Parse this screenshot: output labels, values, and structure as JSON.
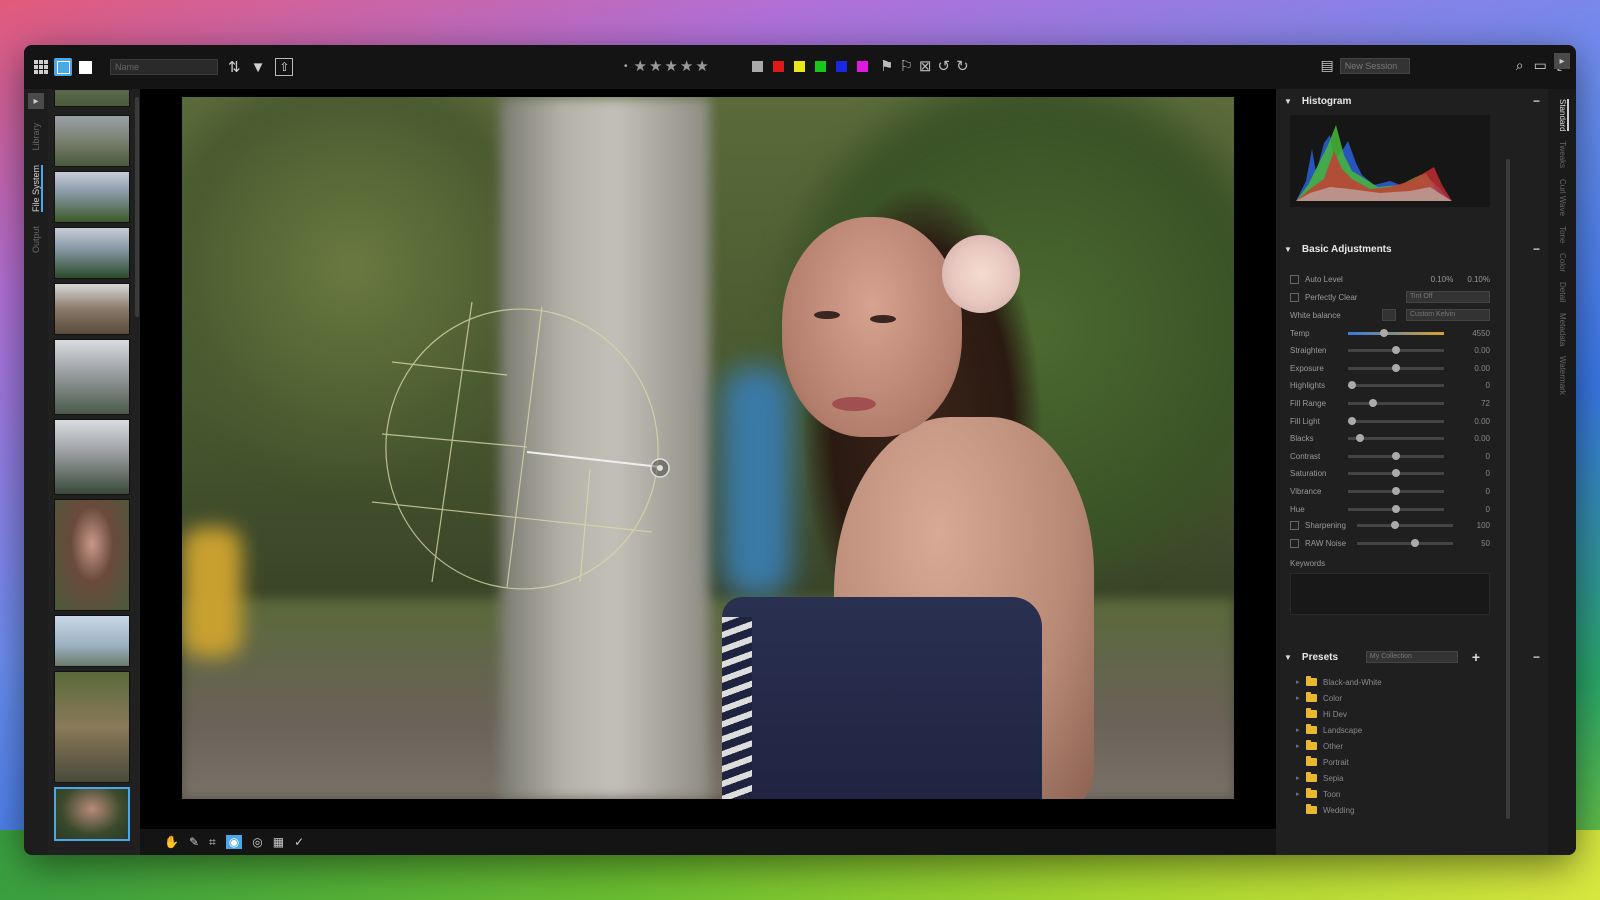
{
  "toolbar": {
    "search_placeholder": "Name",
    "view_select": "New Session"
  },
  "left_tabs": [
    "Library",
    "File System",
    "Output"
  ],
  "main_tools": [
    "pan",
    "brush",
    "crop",
    "spot",
    "eye",
    "mask",
    "pen"
  ],
  "histogram": {
    "title": "Histogram"
  },
  "basic": {
    "title": "Basic Adjustments",
    "auto_level": "Auto Level",
    "auto_level_vals": [
      "0.10%",
      "0.10%"
    ],
    "perfectly_clear": "Perfectly Clear",
    "perfectly_clear_value": "Tint Off",
    "white_balance": "White balance",
    "white_balance_value": "Custom Kelvin",
    "sliders": [
      {
        "label": "Temp",
        "value": "4550",
        "pos": 0.38
      },
      {
        "label": "Straighten",
        "value": "0.00",
        "pos": 0.5
      },
      {
        "label": "Exposure",
        "value": "0.00",
        "pos": 0.5
      },
      {
        "label": "Highlights",
        "value": "0",
        "pos": 0.04
      },
      {
        "label": "Fill Range",
        "value": "72",
        "pos": 0.26
      },
      {
        "label": "Fill Light",
        "value": "0.00",
        "pos": 0.04
      },
      {
        "label": "Blacks",
        "value": "0.00",
        "pos": 0.12
      },
      {
        "label": "Contrast",
        "value": "0",
        "pos": 0.5
      },
      {
        "label": "Saturation",
        "value": "0",
        "pos": 0.5
      },
      {
        "label": "Vibrance",
        "value": "0",
        "pos": 0.5
      },
      {
        "label": "Hue",
        "value": "0",
        "pos": 0.5
      }
    ],
    "sharpening": {
      "label": "Sharpening",
      "value": "100",
      "pos": 0.4
    },
    "raw_noise": {
      "label": "RAW Noise",
      "value": "50",
      "pos": 0.6
    },
    "keywords": "Keywords"
  },
  "presets": {
    "title": "Presets",
    "select": "My Collection",
    "items": [
      {
        "label": "Black-and-White",
        "expandable": true
      },
      {
        "label": "Color",
        "expandable": true
      },
      {
        "label": "Hi Dev",
        "expandable": false
      },
      {
        "label": "Landscape",
        "expandable": true
      },
      {
        "label": "Other",
        "expandable": true
      },
      {
        "label": "Portrait",
        "expandable": false
      },
      {
        "label": "Sepia",
        "expandable": true
      },
      {
        "label": "Toon",
        "expandable": true
      },
      {
        "label": "Wedding",
        "expandable": false
      }
    ]
  },
  "right_tabs": [
    "Standard",
    "Tweaks",
    "Curl Wave",
    "Tone",
    "Color",
    "Detail",
    "Metadata",
    "Watermark"
  ],
  "colors": {
    "accent": "#4aa8e8",
    "red": "#e01818",
    "yellow": "#e8e818",
    "green": "#18c818",
    "blue": "#1828e0",
    "purple": "#e018e0",
    "gray": "#aaaaaa"
  }
}
